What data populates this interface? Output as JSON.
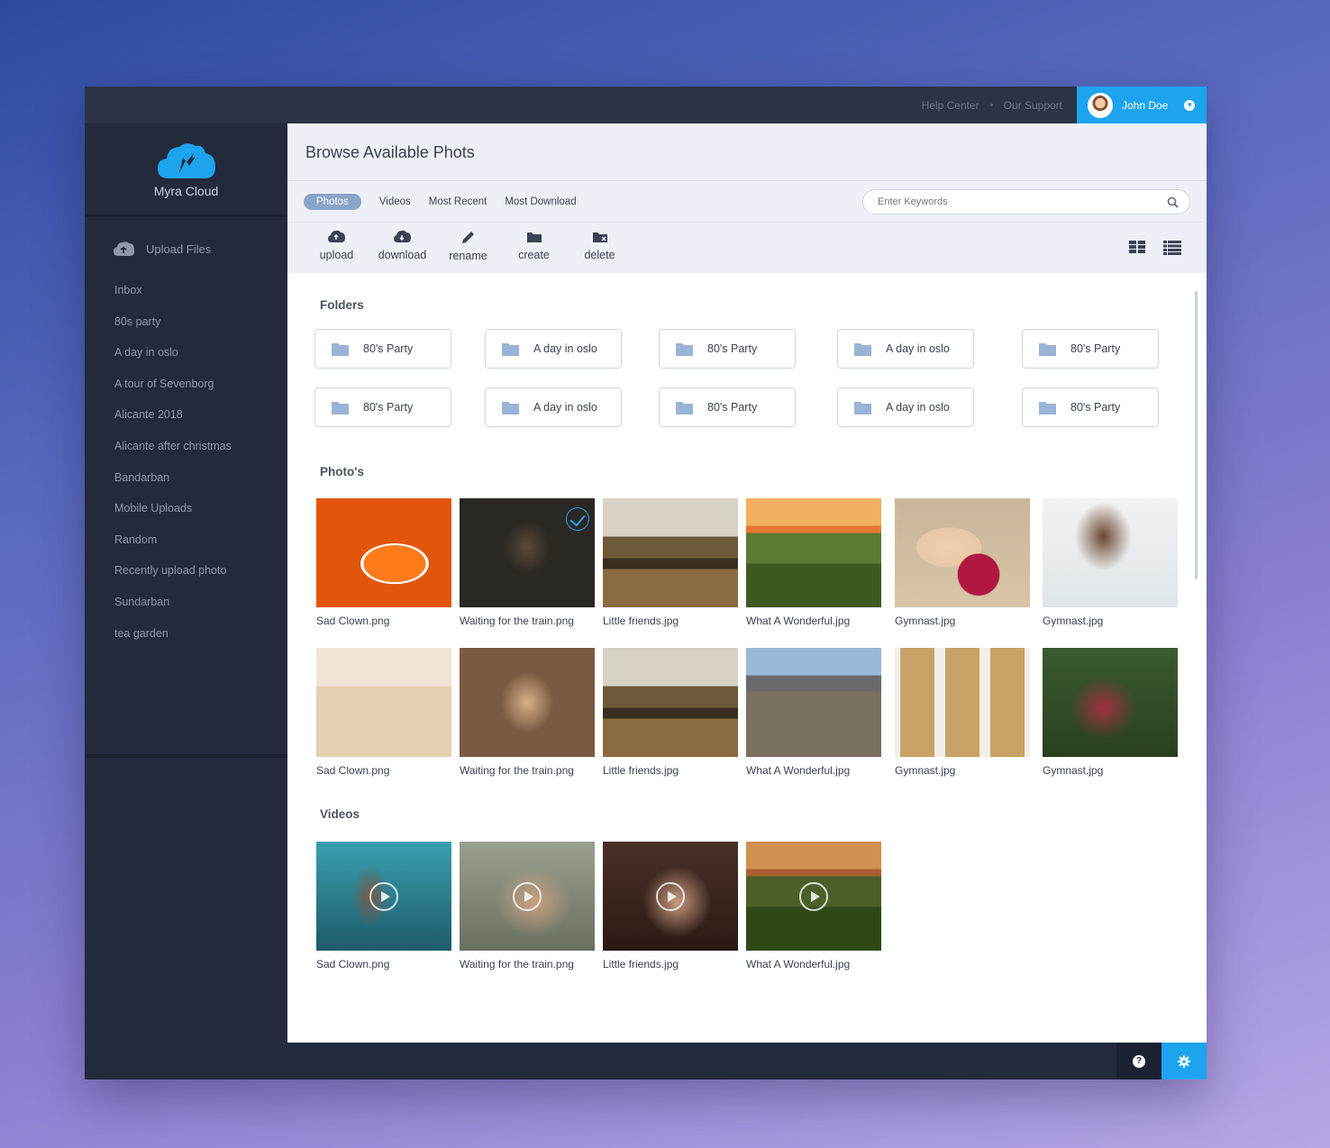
{
  "topbar": {
    "help_center": "Help Center",
    "our_support": "Our Support",
    "user_name": "John Doe"
  },
  "brand": {
    "name": "Myra Cloud"
  },
  "sidebar": {
    "upload_label": "Upload Files",
    "items": [
      "Inbox",
      "80s party",
      "A day in oslo",
      "A tour of Sevenborg",
      "Alicante 2018",
      "Alicante after christmas",
      "Bandarban",
      "Mobile Uploads",
      "Random",
      "Recently upload photo",
      "Sundarban",
      "tea garden"
    ]
  },
  "header": {
    "title": "Browse Available Phots"
  },
  "tabs": [
    "Photos",
    "Videos",
    "Most Recent",
    "Most Download"
  ],
  "search": {
    "placeholder": "Enter Keywords"
  },
  "toolbar": {
    "upload": "upload",
    "download": "download",
    "rename": "rename",
    "create": "create",
    "delete": "delete"
  },
  "sections": {
    "folders": "Folders",
    "photos": "Photo's",
    "videos": "Videos"
  },
  "folders": [
    "80's Party",
    "A day in oslo",
    "80's Party",
    "A day in oslo",
    "80's Party",
    "80's Party",
    "A day in oslo",
    "80's Party",
    "A day in oslo",
    "80's Party"
  ],
  "photos": [
    "Sad Clown.png",
    "Waiting for the train.png",
    "Little friends.jpg",
    "What A Wonderful.jpg",
    "Gymnast.jpg",
    "Gymnast.jpg",
    "Sad Clown.png",
    "Waiting for the train.png",
    "Little friends.jpg",
    "What A Wonderful.jpg",
    "Gymnast.jpg",
    "Gymnast.jpg"
  ],
  "videos": [
    "Sad Clown.png",
    "Waiting for the train.png",
    "Little friends.jpg",
    "What A Wonderful.jpg"
  ],
  "colors": {
    "accent": "#1ea3ef",
    "sidebar": "#232a3b",
    "topbar": "#2c3345"
  }
}
